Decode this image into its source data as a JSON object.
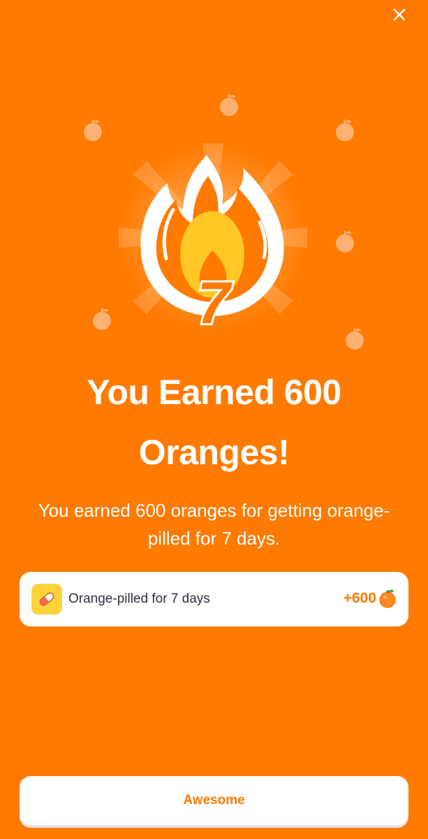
{
  "header": {
    "close_icon": "close-icon"
  },
  "hero": {
    "streak_number": "7",
    "icons": [
      "flame-icon",
      "orange-icon"
    ]
  },
  "title": "You Earned 600 Oranges!",
  "subtitle": "You earned 600 oranges for getting orange-pilled for 7 days.",
  "reward": {
    "icon": "pill-icon",
    "label": "Orange-pilled for 7 days",
    "amount": "+600",
    "amount_icon": "orange-icon"
  },
  "primary_button": {
    "label": "Awesome"
  },
  "colors": {
    "background": "#FF7A00",
    "card": "#FFFFFF",
    "accent": "#FF7A00",
    "flame_inner": "#FFC824",
    "pill_badge": "#FFD23A",
    "text_dark": "#2A2F3D"
  }
}
